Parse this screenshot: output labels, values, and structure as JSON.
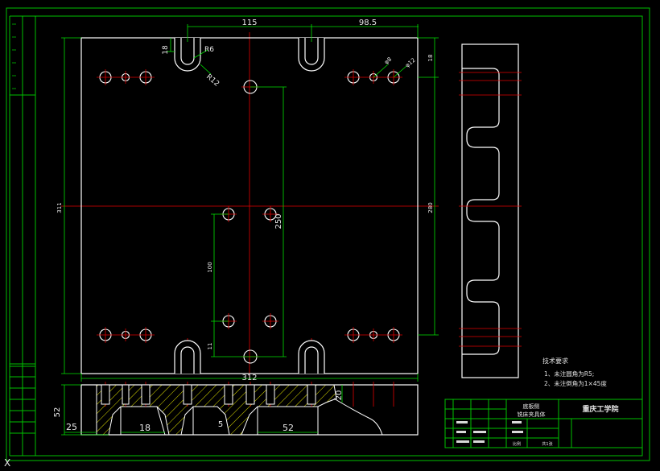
{
  "colors": {
    "background": "#000000",
    "outline": "#ffffff",
    "frame": "#00c000",
    "dimension": "#00e000",
    "centerline": "#e00000",
    "hatch": "#e0e000",
    "text": "#e8e8e8"
  },
  "dimensions": {
    "top_left_span": "115",
    "top_right_span": "98.5",
    "slot_depth": "18",
    "slot_radius_small": "R6",
    "slot_radius_large": "R12",
    "overall_height": "311",
    "right_height": "280",
    "right_top": "18",
    "hole_span_vertical": "250",
    "hole_pair_vertical": "100",
    "hole_small_offset": "11",
    "overall_width": "312",
    "dia_mark_a": "φ8",
    "dia_mark_b": "φ12"
  },
  "section_dimensions": {
    "height": "52",
    "left_offset": "25",
    "pocket_left": "18",
    "web": "5",
    "pocket_right": "52",
    "rib_top": "20"
  },
  "notes": {
    "heading": "技术要求",
    "line1": "1、未注圆角为R5;",
    "line2": "2、未注倒角为1×45度"
  },
  "title_block": {
    "part_name_1": "底板侧",
    "part_name_2": "铣床夹具体",
    "school": "重庆工学院",
    "scale_label": "比例",
    "sheet_label": "共1张"
  },
  "corner_mark": "X"
}
